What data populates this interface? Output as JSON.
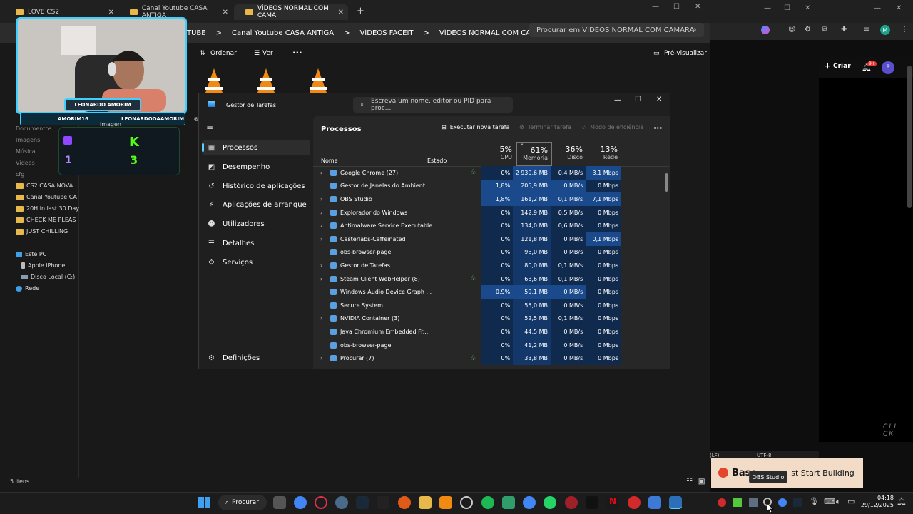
{
  "explorer": {
    "tabs": [
      {
        "label": "LOVE CS2"
      },
      {
        "label": "Canal Youtube CASA ANTIGA"
      },
      {
        "label": "VÍDEOS NORMAL COM CAMA"
      }
    ],
    "breadcrumbs": [
      "TUBE",
      ">",
      "Canal Youtube CASA ANTIGA",
      ">",
      "VÍDEOS FACEIT",
      ">",
      "VÍDEOS NORMAL COM CAMARA"
    ],
    "search_placeholder": "Procurar em VÍDEOS NORMAL COM CAMARA",
    "toolbar": {
      "sort": "Ordenar",
      "view": "Ver",
      "more": "···",
      "preview": "Pré-visualizar"
    },
    "sidebar": {
      "items": [
        "Documentos",
        "Imagens",
        "Música",
        "Vídeos",
        "cfg",
        "CS2 CASA NOVA",
        "Canal Youtube CA",
        "20H in last 30 Day",
        "CHECK ME PLEAS",
        "JUST CHILLING"
      ],
      "this_pc": "Este PC",
      "pc_items": [
        "Apple iPhone",
        "Disco Local (C:)"
      ],
      "network": "Rede"
    },
    "status": "5 itens",
    "overlay_label": "imagen"
  },
  "webcam": {
    "name": "LEONARDO AMORIM",
    "social": [
      "AMORIM16",
      "LEONARDOOAAMORIM"
    ],
    "score_top": "K",
    "score_bottom": "3",
    "side_num": "1"
  },
  "taskmanager": {
    "title": "Gestor de Tarefas",
    "search_placeholder": "Escreva um nome, editor ou PID para proc...",
    "nav": [
      "Processos",
      "Desempenho",
      "Histórico de aplicações",
      "Aplicações de arranque",
      "Utilizadores",
      "Detalhes",
      "Serviços"
    ],
    "settings": "Definições",
    "header": "Processos",
    "actions": {
      "run": "Executar nova tarefa",
      "end": "Terminar tarefa",
      "efficiency": "Modo de eficiência",
      "more": "···"
    },
    "columns": {
      "name": "Nome",
      "state": "Estado",
      "cpu_pct": "5%",
      "cpu": "CPU",
      "mem_pct": "61%",
      "mem": "Memória",
      "disk_pct": "36%",
      "disk": "Disco",
      "net_pct": "13%",
      "net": "Rede"
    },
    "rows": [
      {
        "name": "Google Chrome (27)",
        "expand": true,
        "eco": true,
        "cpu": "0%",
        "mem": "2 930,6 MB",
        "disk": "0,4 MB/s",
        "net": "3,1 Mbps"
      },
      {
        "name": "Gestor de Janelas do Ambient...",
        "expand": false,
        "eco": false,
        "cpu": "1,8%",
        "mem": "205,9 MB",
        "disk": "0 MB/s",
        "net": "0 Mbps"
      },
      {
        "name": "OBS Studio",
        "expand": true,
        "eco": false,
        "cpu": "1,8%",
        "mem": "161,2 MB",
        "disk": "0,1 MB/s",
        "net": "7,1 Mbps"
      },
      {
        "name": "Explorador do Windows",
        "expand": true,
        "eco": false,
        "cpu": "0%",
        "mem": "142,9 MB",
        "disk": "0,5 MB/s",
        "net": "0 Mbps"
      },
      {
        "name": "Antimalware Service Executable",
        "expand": true,
        "eco": false,
        "cpu": "0%",
        "mem": "134,0 MB",
        "disk": "0,6 MB/s",
        "net": "0 Mbps"
      },
      {
        "name": "Casterlabs-Caffeinated",
        "expand": true,
        "eco": false,
        "cpu": "0%",
        "mem": "121,8 MB",
        "disk": "0 MB/s",
        "net": "0,1 Mbps"
      },
      {
        "name": "obs-browser-page",
        "expand": false,
        "eco": false,
        "cpu": "0%",
        "mem": "98,0 MB",
        "disk": "0 MB/s",
        "net": "0 Mbps"
      },
      {
        "name": "Gestor de Tarefas",
        "expand": true,
        "eco": false,
        "cpu": "0%",
        "mem": "80,0 MB",
        "disk": "0,1 MB/s",
        "net": "0 Mbps"
      },
      {
        "name": "Steam Client WebHelper (8)",
        "expand": true,
        "eco": true,
        "cpu": "0%",
        "mem": "63,6 MB",
        "disk": "0,1 MB/s",
        "net": "0 Mbps"
      },
      {
        "name": "Windows Audio Device Graph ...",
        "expand": false,
        "eco": false,
        "cpu": "0,9%",
        "mem": "59,1 MB",
        "disk": "0 MB/s",
        "net": "0 Mbps"
      },
      {
        "name": "Secure System",
        "expand": false,
        "eco": false,
        "cpu": "0%",
        "mem": "55,0 MB",
        "disk": "0 MB/s",
        "net": "0 Mbps"
      },
      {
        "name": "NVIDIA Container (3)",
        "expand": true,
        "eco": false,
        "cpu": "0%",
        "mem": "52,5 MB",
        "disk": "0,1 MB/s",
        "net": "0 Mbps"
      },
      {
        "name": "Java Chromium Embedded Fr...",
        "expand": false,
        "eco": false,
        "cpu": "0%",
        "mem": "44,5 MB",
        "disk": "0 MB/s",
        "net": "0 Mbps"
      },
      {
        "name": "obs-browser-page",
        "expand": false,
        "eco": false,
        "cpu": "0%",
        "mem": "41,2 MB",
        "disk": "0 MB/s",
        "net": "0 Mbps"
      },
      {
        "name": "Procurar (7)",
        "expand": true,
        "eco": true,
        "cpu": "0%",
        "mem": "33,8 MB",
        "disk": "0 MB/s",
        "net": "0 Mbps"
      }
    ]
  },
  "browser": {
    "create": "Criar",
    "notif_badge": "9+",
    "avatar": "P",
    "avatar_m": "M",
    "watermark": "CLI CK",
    "ide_status": {
      "eol": "(LF)",
      "encoding": "UTF-8"
    },
    "banner": "Base",
    "banner_tail": "st Start Building"
  },
  "taskbar": {
    "search": "Procurar",
    "tooltip": "OBS Studio",
    "time": "04:18",
    "date": "29/12/2025"
  },
  "colors": {
    "accent": "#60cdff",
    "cpu_heat_high": "#1a4a8c",
    "cpu_heat_low": "#0f2a4d",
    "eco_leaf": "#6ccf6c",
    "webcam_border": "#3fd0ff"
  }
}
